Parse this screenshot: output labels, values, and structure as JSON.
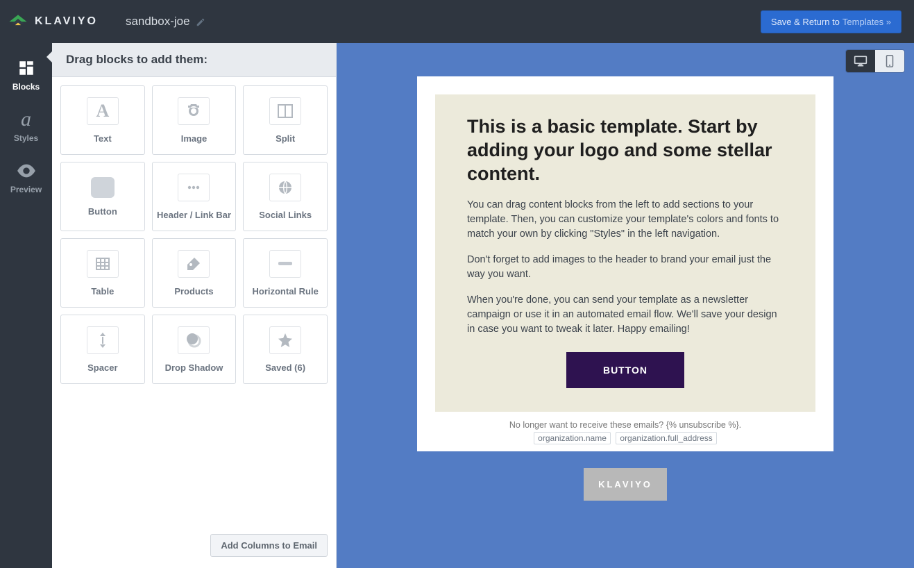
{
  "topbar": {
    "brand": "KLAVIYO",
    "template_name": "sandbox-joe",
    "save_label_prefix": "Save & Return to ",
    "save_label_link": "Templates »"
  },
  "rail": {
    "items": [
      {
        "id": "blocks",
        "label": "Blocks"
      },
      {
        "id": "styles",
        "label": "Styles"
      },
      {
        "id": "preview",
        "label": "Preview"
      }
    ]
  },
  "panel": {
    "header": "Drag blocks to add them:",
    "add_columns_label": "Add Columns to Email",
    "tiles": [
      {
        "id": "text",
        "label": "Text"
      },
      {
        "id": "image",
        "label": "Image"
      },
      {
        "id": "split",
        "label": "Split"
      },
      {
        "id": "button",
        "label": "Button"
      },
      {
        "id": "header-link-bar",
        "label": "Header / Link Bar"
      },
      {
        "id": "social-links",
        "label": "Social Links"
      },
      {
        "id": "table",
        "label": "Table"
      },
      {
        "id": "products",
        "label": "Products"
      },
      {
        "id": "horizontal-rule",
        "label": "Horizontal Rule"
      },
      {
        "id": "spacer",
        "label": "Spacer"
      },
      {
        "id": "drop-shadow",
        "label": "Drop Shadow"
      },
      {
        "id": "saved",
        "label": "Saved (6)"
      }
    ]
  },
  "email": {
    "heading": "This is a basic template. Start by adding your logo and some stellar content.",
    "p1": "You can drag content blocks from the left to add sections to your template. Then, you can customize your template's colors and fonts to match your own by clicking \"Styles\" in the left navigation.",
    "p2": "Don't forget to add images to the header to brand your email just the way you want.",
    "p3": "When you're done, you can send your template as a newsletter campaign or use it in an automated email flow. We'll save your design in case you want to tweak it later. Happy emailing!",
    "cta": "BUTTON",
    "unsubscribe": "No longer want to receive these emails? {% unsubscribe %}.",
    "org_name_chip": "organization.name",
    "org_addr_chip": "organization.full_address",
    "powered": "KLAVIYO"
  }
}
